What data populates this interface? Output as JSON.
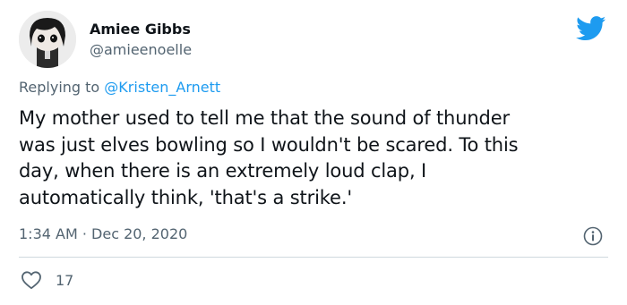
{
  "tweet": {
    "author": {
      "display_name": "Amiee Gibbs",
      "handle": "@amieenoelle",
      "avatar_icon": "funko-figure-avatar"
    },
    "platform_icon": "twitter-bird-icon",
    "reply_prefix": "Replying to",
    "reply_to": "@Kristen_Arnett",
    "body_lines": [
      "My mother used to tell me that the sound of thunder",
      "was just elves bowling so I wouldn't be scared. To this",
      "day, when there is an extremely loud clap, I",
      "automatically think, 'that's a strike.'"
    ],
    "timestamp": "1:34 AM · Dec 20, 2020",
    "info_icon": "info-icon",
    "likes": "17",
    "like_icon": "heart-icon"
  },
  "colors": {
    "text_primary": "#0f1419",
    "text_secondary": "#536471",
    "link": "#1d9bf0",
    "twitter_blue": "#1d9bf0",
    "divider": "#cfd9de"
  }
}
